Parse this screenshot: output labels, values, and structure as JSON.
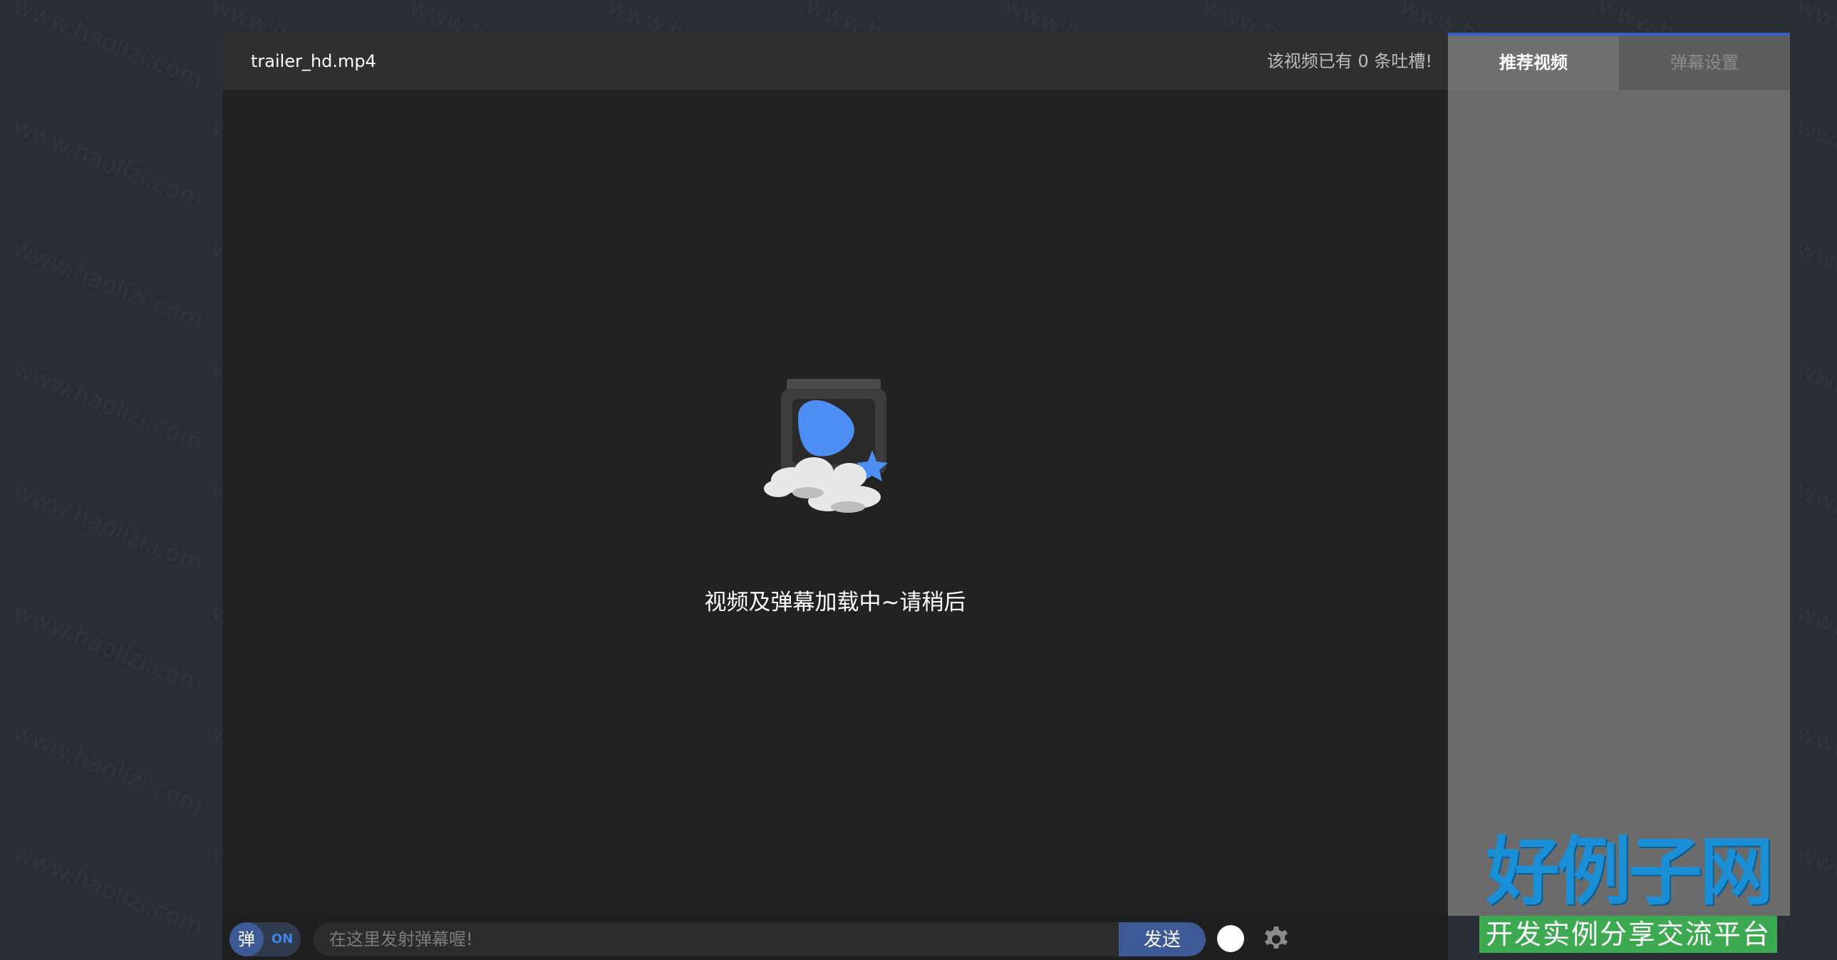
{
  "player": {
    "video_title": "trailer_hd.mp4",
    "comment_count_text": "该视频已有 0 条吐槽!",
    "loading_text": "视频及弹幕加载中~请稍后"
  },
  "side_panel": {
    "tabs": [
      {
        "label": "推荐视频",
        "active": true
      },
      {
        "label": "弹幕设置",
        "active": false
      }
    ]
  },
  "control_bar": {
    "danmaku_toggle_char": "弹",
    "danmaku_toggle_state": "ON",
    "danmaku_input_placeholder": "在这里发射弹幕喔!",
    "danmaku_input_value": "",
    "send_label": "发送",
    "selected_color": "#ffffff",
    "settings_icon": "gear-icon"
  },
  "watermark": {
    "text": "www.haolizi.com"
  },
  "logo": {
    "main": "好例子网",
    "sub": "开发实例分享交流平台"
  },
  "colors": {
    "page_bg": "#2b2d34",
    "video_bg": "#222222",
    "accent_blue": "#3d5a96",
    "side_panel_bg": "#6b6b6b",
    "logo_blue": "#1a8fd6",
    "logo_green": "#3daa52"
  }
}
